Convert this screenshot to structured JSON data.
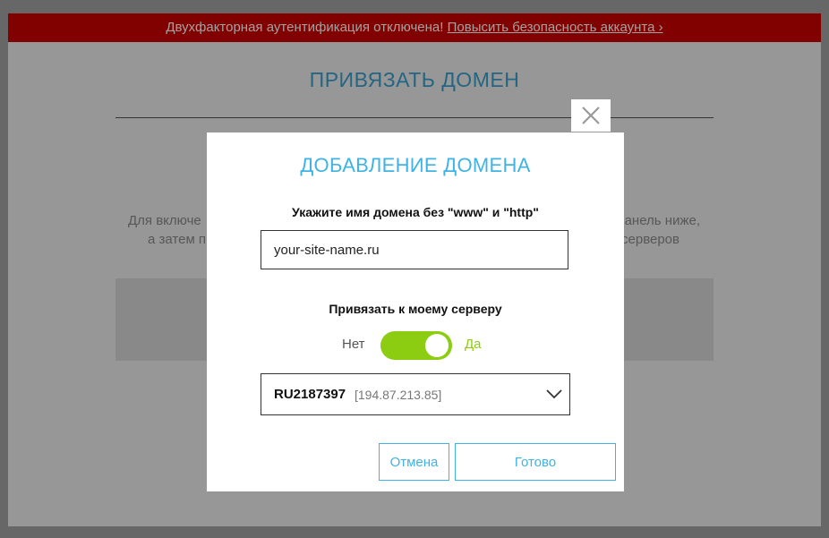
{
  "alert": {
    "text": "Двухфакторная аутентификация отключена!",
    "link": "Повысить безопасность аккаунта ›"
  },
  "page": {
    "title": "ПРИВЯЗАТЬ ДОМЕН",
    "text_line1_left": "Для включе",
    "text_line1_right": "анель ниже,",
    "text_line2_left": "а затем п",
    "text_line2_right": "серверов"
  },
  "modal": {
    "title": "ДОБАВЛЕНИЕ ДОМЕНА",
    "domain_label": "Укажите имя домена без \"www\" и \"http\"",
    "domain_value": "your-site-name.ru",
    "bind_label": "Привязать к моему серверу",
    "toggle_off_label": "Нет",
    "toggle_on_label": "Да",
    "toggle_state": true,
    "server_id": "RU2187397",
    "server_ip": "[194.87.213.85]",
    "cancel_label": "Отмена",
    "done_label": "Готово"
  },
  "icons": {
    "close": "close-icon",
    "chevron": "chevron-down-icon"
  },
  "colors": {
    "alert_bg": "#cc0000",
    "accent": "#3fb3e3",
    "toggle_on": "#8ccd12"
  }
}
